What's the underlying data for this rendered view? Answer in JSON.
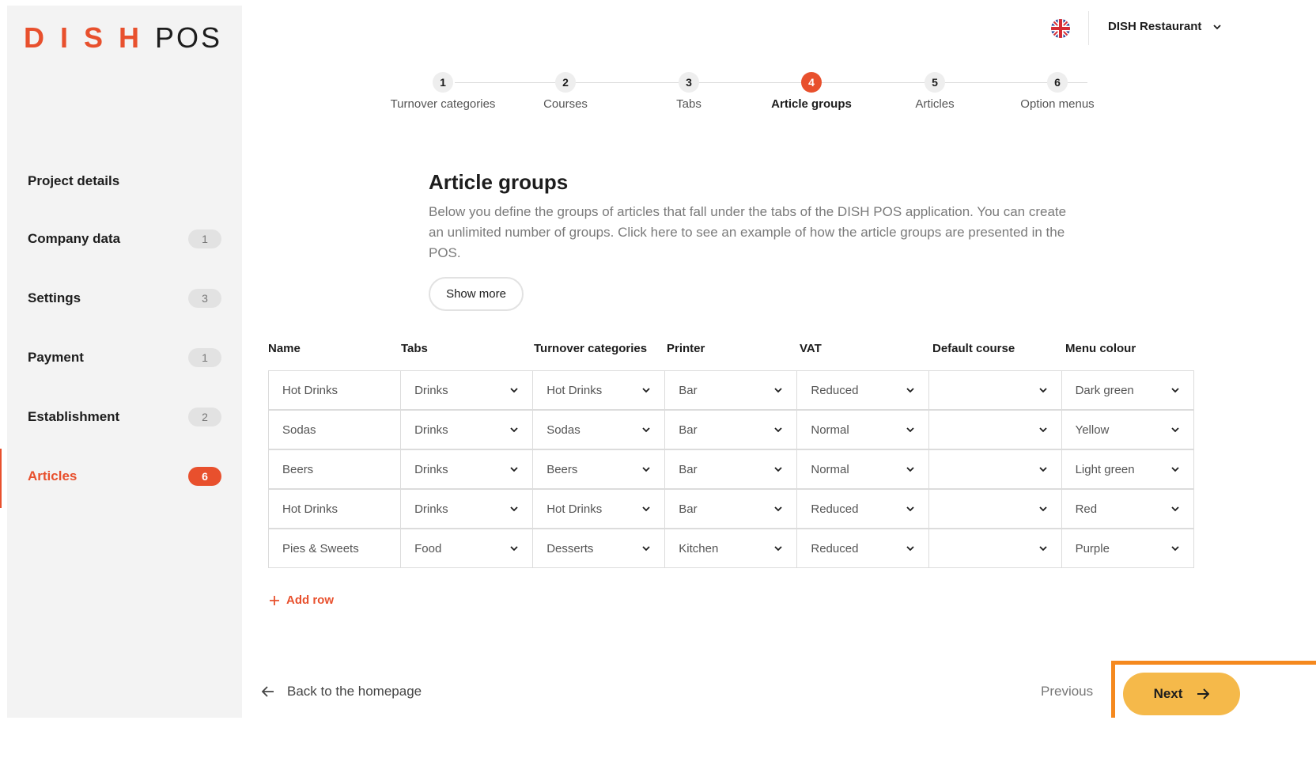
{
  "brand": {
    "dish": "DISH",
    "pos": "POS",
    "accent": "#e8502d"
  },
  "header": {
    "restaurant": "DISH Restaurant",
    "language_icon": "uk-flag-icon"
  },
  "sidebar": {
    "items": [
      {
        "label": "Project details",
        "badge": ""
      },
      {
        "label": "Company data",
        "badge": "1"
      },
      {
        "label": "Settings",
        "badge": "3"
      },
      {
        "label": "Payment",
        "badge": "1"
      },
      {
        "label": "Establishment",
        "badge": "2"
      },
      {
        "label": "Articles",
        "badge": "6",
        "active": true
      }
    ]
  },
  "stepper": {
    "steps": [
      {
        "num": "1",
        "label": "Turnover categories"
      },
      {
        "num": "2",
        "label": "Courses"
      },
      {
        "num": "3",
        "label": "Tabs"
      },
      {
        "num": "4",
        "label": "Article groups",
        "active": true
      },
      {
        "num": "5",
        "label": "Articles"
      },
      {
        "num": "6",
        "label": "Option menus"
      }
    ]
  },
  "main": {
    "title": "Article groups",
    "description": "Below you define the groups of articles that fall under the tabs of the DISH POS application. You can create an unlimited number of groups. Click here to see an example of how the article groups are presented in the POS.",
    "show_more": "Show more",
    "columns": [
      "Name",
      "Tabs",
      "Turnover categories",
      "Printer",
      "VAT",
      "Default course",
      "Menu colour"
    ],
    "rows": [
      [
        "Hot Drinks",
        "Drinks",
        "Hot Drinks",
        "Bar",
        "Reduced",
        "",
        "Dark green"
      ],
      [
        "Sodas",
        "Drinks",
        "Sodas",
        "Bar",
        "Normal",
        "",
        "Yellow"
      ],
      [
        "Beers",
        "Drinks",
        "Beers",
        "Bar",
        "Normal",
        "",
        "Light green"
      ],
      [
        "Hot Drinks",
        "Drinks",
        "Hot Drinks",
        "Bar",
        "Reduced",
        "",
        "Red"
      ],
      [
        "Pies & Sweets",
        "Food",
        "Desserts",
        "Kitchen",
        "Reduced",
        "",
        "Purple"
      ]
    ],
    "add_row": "Add row"
  },
  "footer": {
    "back": "Back to the homepage",
    "previous": "Previous",
    "next": "Next",
    "next_color": "#f5b94a"
  }
}
